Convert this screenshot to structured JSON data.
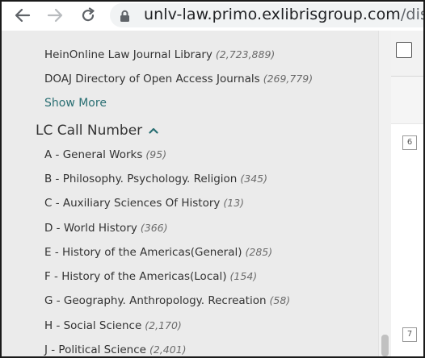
{
  "browser": {
    "url_host": "unlv-law.primo.exlibrisgroup.com",
    "url_path": "/discovery/s"
  },
  "facets": {
    "top_items": [
      {
        "label": "HeinOnline Law Journal Library",
        "count": "(2,723,889)"
      },
      {
        "label": "DOAJ Directory of Open Access Journals",
        "count": "(269,779)"
      }
    ],
    "show_more": "Show More",
    "section_title": "LC Call Number",
    "lc_items": [
      {
        "label": "A - General Works",
        "count": "(95)"
      },
      {
        "label": "B - Philosophy. Psychology. Religion",
        "count": "(345)"
      },
      {
        "label": "C - Auxiliary Sciences Of History",
        "count": "(13)"
      },
      {
        "label": "D - World History",
        "count": "(366)"
      },
      {
        "label": "E - History of the Americas(General)",
        "count": "(285)"
      },
      {
        "label": "F - History of the Americas(Local)",
        "count": "(154)"
      },
      {
        "label": "G - Geography. Anthropology. Recreation",
        "count": "(58)"
      },
      {
        "label": "H - Social Science",
        "count": "(2,170)"
      },
      {
        "label": "J - Political Science",
        "count": "(2,401)"
      }
    ]
  },
  "results": {
    "row_numbers": [
      "6",
      "7"
    ]
  },
  "colors": {
    "panel_bg": "#ebebeb",
    "link": "#2a6f73",
    "text": "#333333"
  }
}
